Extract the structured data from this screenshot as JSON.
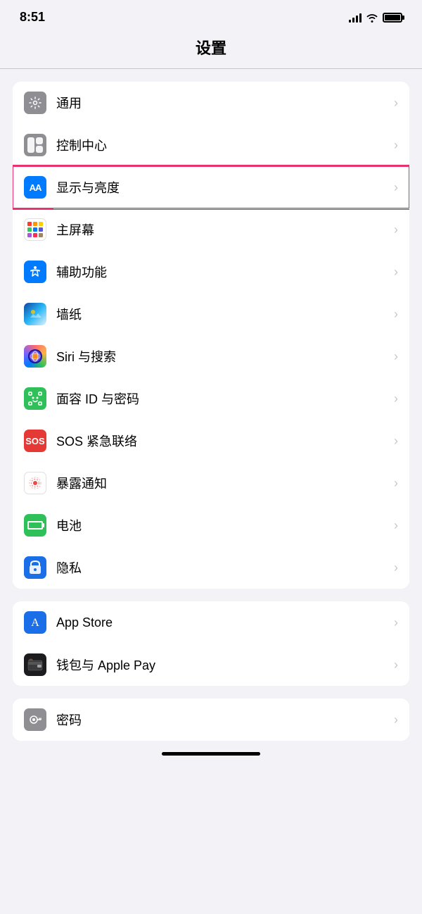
{
  "statusBar": {
    "time": "8:51",
    "signal": "signal",
    "wifi": "wifi",
    "battery": "battery"
  },
  "pageTitle": "设置",
  "settingsGroups": [
    {
      "id": "group1",
      "items": [
        {
          "id": "tongyong",
          "label": "通用",
          "iconClass": "icon-tongyong",
          "iconType": "gear",
          "highlighted": false
        },
        {
          "id": "kongzhi",
          "label": "控制中心",
          "iconClass": "icon-kongzhi",
          "iconType": "control",
          "highlighted": false
        },
        {
          "id": "xianshi",
          "label": "显示与亮度",
          "iconClass": "icon-xianshi",
          "iconType": "aa",
          "highlighted": true
        },
        {
          "id": "zhupingmu",
          "label": "主屏幕",
          "iconClass": "icon-zhupingmu",
          "iconType": "grid",
          "highlighted": false
        },
        {
          "id": "fuzhugongneng",
          "label": "辅助功能",
          "iconClass": "icon-fuzhugongneng",
          "iconType": "accessibility",
          "highlighted": false
        },
        {
          "id": "zhuzhi",
          "label": "墙纸",
          "iconClass": "icon-zhuzhi",
          "iconType": "wallpaper",
          "highlighted": false
        },
        {
          "id": "siri",
          "label": "Siri 与搜索",
          "iconClass": "icon-siri",
          "iconType": "siri",
          "highlighted": false
        },
        {
          "id": "mianrong",
          "label": "面容 ID 与密码",
          "iconClass": "icon-mianrong",
          "iconType": "faceid",
          "highlighted": false
        },
        {
          "id": "sos",
          "label": "SOS 紧急联络",
          "iconClass": "icon-sos",
          "iconType": "sos",
          "highlighted": false
        },
        {
          "id": "baolu",
          "label": "暴露通知",
          "iconClass": "icon-baolusf",
          "iconType": "exposure",
          "highlighted": false
        },
        {
          "id": "dianci",
          "label": "电池",
          "iconClass": "icon-dianci",
          "iconType": "battery",
          "highlighted": false
        },
        {
          "id": "yinsi",
          "label": "隐私",
          "iconClass": "icon-yinsi",
          "iconType": "hand",
          "highlighted": false
        }
      ]
    },
    {
      "id": "group2",
      "items": [
        {
          "id": "appstore",
          "label": "App Store",
          "iconClass": "icon-appstore",
          "iconType": "appstore",
          "highlighted": false
        },
        {
          "id": "qianbao",
          "label": "钱包与 Apple Pay",
          "iconClass": "icon-qianbao",
          "iconType": "wallet",
          "highlighted": false
        }
      ]
    },
    {
      "id": "group3",
      "items": [
        {
          "id": "mima",
          "label": "密码",
          "iconClass": "icon-mima",
          "iconType": "key",
          "highlighted": false
        }
      ]
    }
  ]
}
